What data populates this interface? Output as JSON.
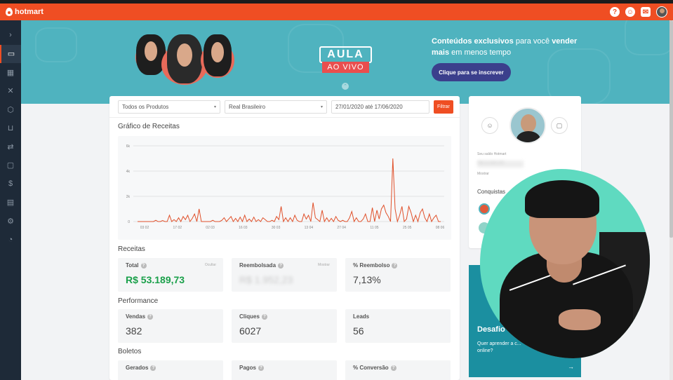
{
  "header": {
    "logo": "hotmart",
    "icons": [
      "help-icon",
      "community-icon",
      "chat-icon",
      "avatar"
    ]
  },
  "sidebar": {
    "items": [
      "expand-icon",
      "dashboard-icon",
      "table-icon",
      "network-icon",
      "box-icon",
      "cart-icon",
      "transfer-icon",
      "message-icon",
      "dollar-icon",
      "analytics-icon",
      "settings-icon",
      "gauge-icon"
    ]
  },
  "banner": {
    "aula_line1": "AULA",
    "aula_line2": "AO VIVO",
    "text_bold1": "Conteúdos exclusivos",
    "text_normal1": " para você ",
    "text_bold2": "vender mais",
    "text_normal2": " em menos tempo",
    "cta_label": "Clique para se inscrever"
  },
  "filters": {
    "product": "Todos os Produtos",
    "currency": "Real Brasileiro",
    "date_range": "27/01/2020 até 17/06/2020",
    "filter_label": "Filtrar"
  },
  "chart_section_title": "Gráfico de Receitas",
  "chart_data": {
    "type": "line",
    "title": "",
    "xlabel": "",
    "ylabel": "",
    "ylim": [
      0,
      6000
    ],
    "y_ticks": [
      "0",
      "2k",
      "4k",
      "6k"
    ],
    "x_ticks": [
      "03 02",
      "17 02",
      "02 03",
      "16 03",
      "30 03",
      "13 04",
      "27 04",
      "11 05",
      "25 05",
      "08 06"
    ],
    "series": [
      {
        "color": "#e0502a",
        "values": [
          0,
          0,
          0,
          0,
          0,
          0,
          0,
          0,
          100,
          0,
          0,
          80,
          0,
          0,
          500,
          0,
          150,
          0,
          300,
          0,
          400,
          150,
          500,
          0,
          250,
          600,
          0,
          1000,
          0,
          0,
          0,
          0,
          0,
          100,
          0,
          0,
          0,
          100,
          300,
          0,
          200,
          400,
          0,
          250,
          0,
          350,
          0,
          500,
          0,
          200,
          0,
          350,
          0,
          150,
          0,
          300,
          150,
          0,
          0,
          100,
          0,
          400,
          150,
          1200,
          0,
          300,
          0,
          300,
          0,
          500,
          100,
          0,
          0,
          600,
          200,
          500,
          0,
          1500,
          300,
          150,
          0,
          900,
          0,
          300,
          0,
          250,
          0,
          400,
          100,
          0,
          100,
          0,
          0,
          300,
          800,
          0,
          300,
          0,
          0,
          200,
          600,
          0,
          0,
          1100,
          0,
          900,
          200,
          1000,
          1300,
          700,
          400,
          0,
          5000,
          1000,
          0,
          500,
          1200,
          0,
          200,
          1200,
          700,
          0,
          500,
          0,
          700,
          1000,
          300,
          0,
          600,
          0,
          300,
          500,
          0,
          0
        ]
      }
    ],
    "grid": true,
    "legend": "none"
  },
  "receitas": {
    "title": "Receitas",
    "cards": [
      {
        "label": "Total",
        "value": "R$ 53.189,73",
        "link": "Ocultar"
      },
      {
        "label": "Reembolsada",
        "value": "R$ 1.952,23",
        "link": "Mostrar"
      },
      {
        "label": "% Reembolso",
        "value": "7,13%",
        "link": ""
      }
    ]
  },
  "performance": {
    "title": "Performance",
    "cards": [
      {
        "label": "Vendas",
        "value": "382"
      },
      {
        "label": "Cliques",
        "value": "6027"
      },
      {
        "label": "Leads",
        "value": "56"
      }
    ]
  },
  "boletos": {
    "title": "Boletos",
    "cards": [
      {
        "label": "Gerados"
      },
      {
        "label": "Pagos"
      },
      {
        "label": "% Conversão"
      }
    ]
  },
  "profile": {
    "saldo_label": "Seu saldo Hotmart",
    "saldo_value": "R$ 0.000,00",
    "mostrar": "Mostrar",
    "conquistas": "Conquistas"
  },
  "desafio": {
    "title": "Desafio",
    "desc": "Quer aprender a c... online?",
    "arrow": "→"
  }
}
